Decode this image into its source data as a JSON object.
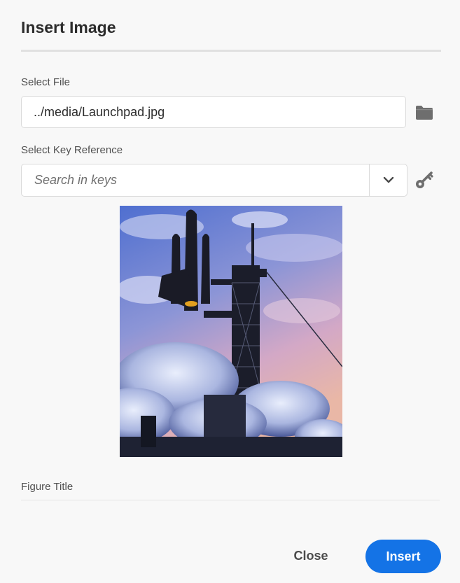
{
  "dialog": {
    "title": "Insert Image"
  },
  "select_file": {
    "label": "Select File",
    "value": "../media/Launchpad.jpg",
    "browse_icon": "folder-icon"
  },
  "key_reference": {
    "label": "Select Key Reference",
    "placeholder": "Search in keys",
    "dropdown_icon": "chevron-down-icon",
    "key_icon": "key-icon"
  },
  "preview": {
    "subject": "space-shuttle-launch-image"
  },
  "figure_title": {
    "label": "Figure Title",
    "value": ""
  },
  "footer": {
    "close_label": "Close",
    "insert_label": "Insert"
  },
  "colors": {
    "accent": "#1473e6",
    "background": "#f8f8f8"
  }
}
